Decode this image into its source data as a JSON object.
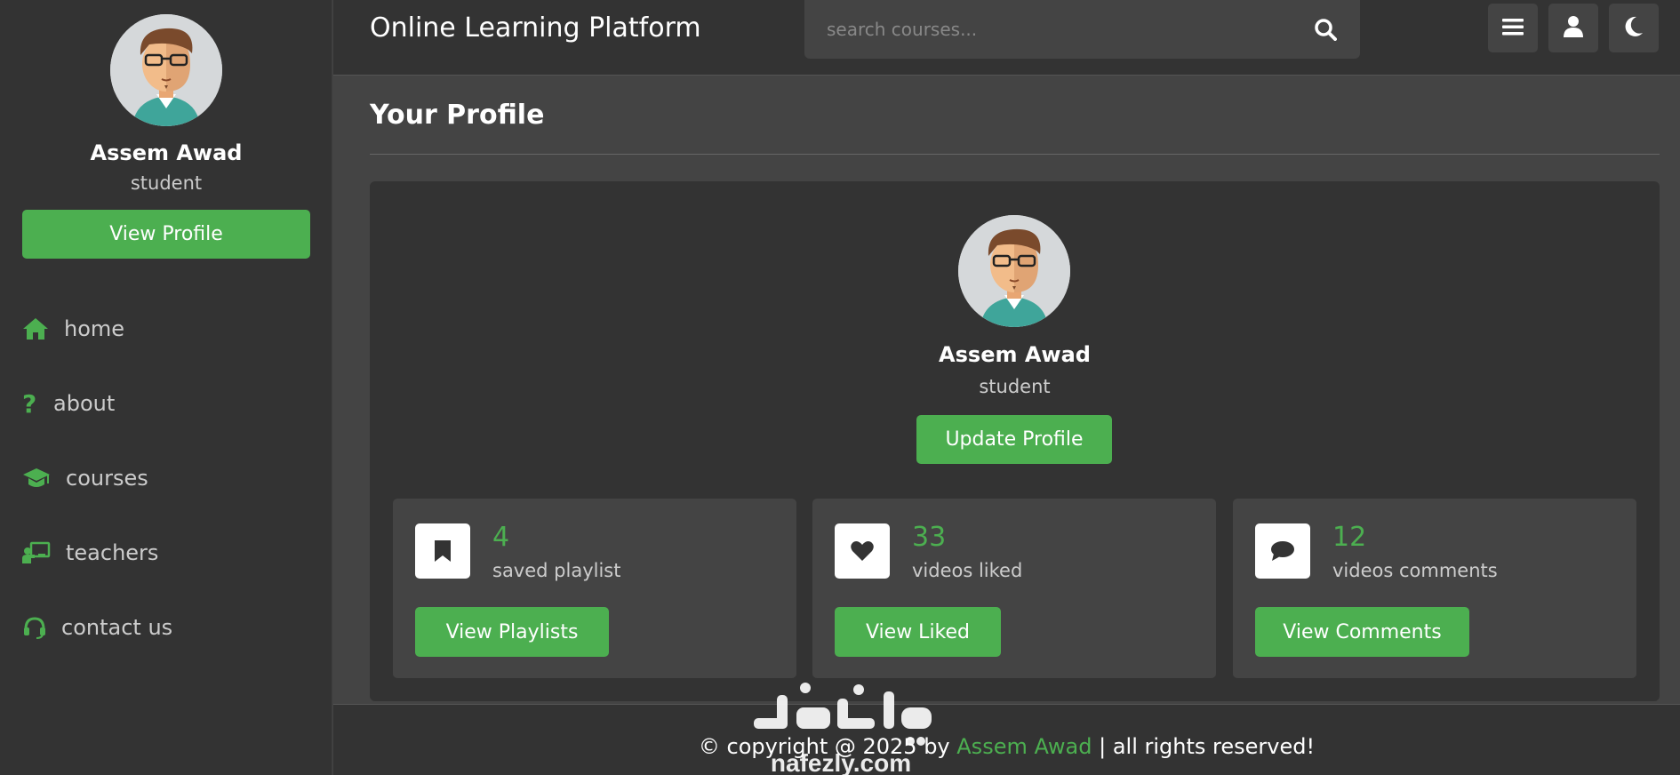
{
  "sidebar": {
    "user_name": "Assem Awad",
    "user_role": "student",
    "view_profile_label": "View Profile",
    "nav": [
      {
        "label": "home",
        "icon": "home-icon"
      },
      {
        "label": "about",
        "icon": "question-icon"
      },
      {
        "label": "courses",
        "icon": "graduation-cap-icon"
      },
      {
        "label": "teachers",
        "icon": "chalkboard-teacher-icon"
      },
      {
        "label": "contact us",
        "icon": "headset-icon"
      }
    ]
  },
  "header": {
    "title": "Online Learning Platform",
    "search_placeholder": "search courses...",
    "buttons": [
      "menu-icon",
      "user-icon",
      "moon-icon"
    ]
  },
  "main": {
    "heading": "Your Profile",
    "user_name": "Assem Awad",
    "user_role": "student",
    "update_label": "Update Profile",
    "cards": [
      {
        "icon": "bookmark-icon",
        "count": "4",
        "label": "saved playlist",
        "button": "View Playlists"
      },
      {
        "icon": "heart-icon",
        "count": "33",
        "label": "videos liked",
        "button": "View Liked"
      },
      {
        "icon": "comment-icon",
        "count": "12",
        "label": "videos comments",
        "button": "View Comments"
      }
    ]
  },
  "footer": {
    "prefix": "© copyright @ 2025 by ",
    "author": "Assem Awad",
    "suffix": " | all rights reserved!"
  },
  "watermark": {
    "arabic": "نفذلي",
    "latin": "nafezly.com"
  },
  "colors": {
    "accent": "#4caf50",
    "sidebar_bg": "#333333",
    "page_bg": "#444444"
  }
}
